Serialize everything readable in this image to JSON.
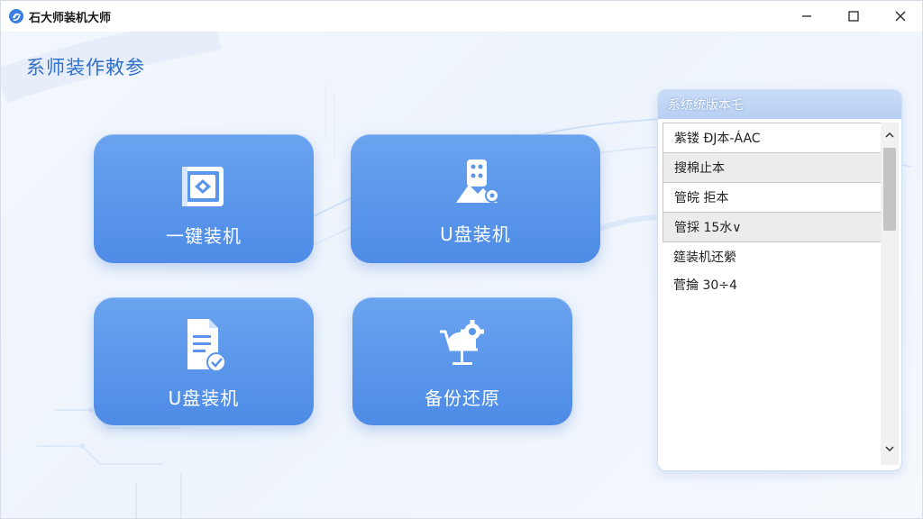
{
  "window": {
    "title": "石大师装机大师",
    "icons": {
      "app": "app-logo-icon",
      "minimize": "minimize-icon",
      "maximize": "maximize-icon",
      "close": "close-icon"
    }
  },
  "page": {
    "title": "系师装作敕参"
  },
  "tiles": [
    {
      "label": "一键装机",
      "icon": "install-disk-icon"
    },
    {
      "label": "U盘装机",
      "icon": "usb-boot-icon"
    },
    {
      "label": "U盘装机",
      "icon": "document-check-icon"
    },
    {
      "label": "备份还原",
      "icon": "backup-restore-icon"
    }
  ],
  "version_panel": {
    "title": "系统统版本乇",
    "items": [
      "紫镂 ÐJ本-ÁAC",
      "搜棉止本",
      "管皖 拒本",
      "管採 15水∨",
      "筵装机还縈",
      "菅掄 30÷4"
    ],
    "scroll_up_icon": "chevron-up-icon",
    "scroll_down_icon": "chevron-down-icon"
  },
  "colors": {
    "tile": "#5a95ea",
    "title": "#2f6fc9",
    "panel_header": "#bfd5f5"
  }
}
